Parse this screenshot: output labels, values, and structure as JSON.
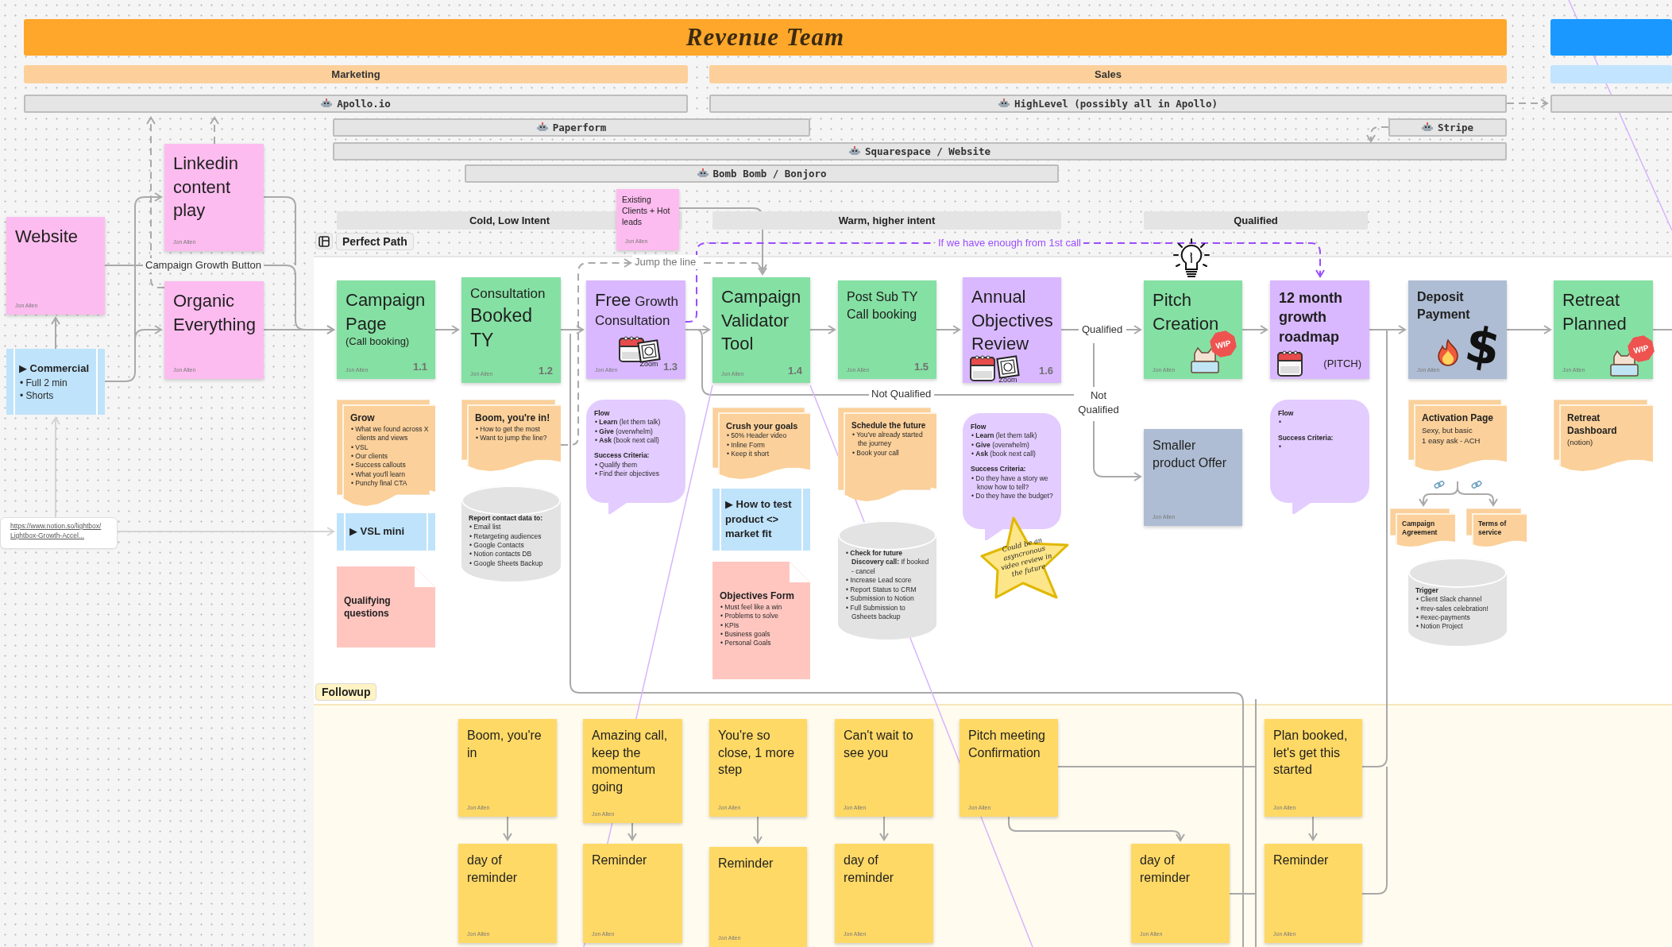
{
  "header": {
    "title": "Revenue Team"
  },
  "departments": [
    {
      "label": "Marketing"
    },
    {
      "label": "Sales"
    }
  ],
  "tools": [
    {
      "label": "Apollo.io"
    },
    {
      "label": "HighLevel (possibly all in Apollo)"
    },
    {
      "label": "Paperform"
    },
    {
      "label": "Stripe"
    },
    {
      "label": "Squarespace / Website"
    },
    {
      "label": "Bomb Bomb / Bonjoro"
    }
  ],
  "stages": [
    {
      "label": "Cold, Low Intent"
    },
    {
      "label": "Warm, higher intent"
    },
    {
      "label": "Qualified"
    }
  ],
  "sections": [
    {
      "label": "Perfect Path"
    },
    {
      "label": "Followup"
    }
  ],
  "labels": [
    {
      "text": "Campaign Growth Button"
    },
    {
      "text": "Jump the line"
    },
    {
      "text": "If we have enough from 1st call"
    },
    {
      "text": "Qualified"
    },
    {
      "text": "Not Qualified"
    },
    {
      "text": "Not Qualified"
    }
  ],
  "notes": [
    {
      "kind": "sticky",
      "color": "#fdbcef",
      "title": "Linkedin content play",
      "author": "Jon Allen"
    },
    {
      "kind": "sticky",
      "color": "#fdbcef",
      "lead": "Existing Clients + Hot leads",
      "author": "Jon Allen"
    },
    {
      "kind": "sticky",
      "color": "#fdbcef",
      "title": "Website",
      "author": "Jon Allen"
    },
    {
      "kind": "sticky",
      "color": "#fdbcef",
      "title": "Organic Everything",
      "author": "Jon Allen"
    },
    {
      "kind": "sticky",
      "color": "#85e0a3",
      "title": "Campaign Page",
      "subtitle": "(Call booking)",
      "author": "Jon Allen",
      "number": "1.1"
    },
    {
      "kind": "sticky",
      "color": "#85e0a3",
      "lead": "Consultation",
      "title": "Booked TY",
      "author": "Jon Allen",
      "number": "1.2"
    },
    {
      "kind": "sticky",
      "color": "#d9b8ff",
      "title": "Free",
      "tail": "Growth Consultation",
      "author": "Jon Allen",
      "number": "1.3",
      "stickers": [
        {
          "kind": "calendar"
        },
        {
          "kind": "zoom",
          "caption": "Zoom"
        }
      ]
    },
    {
      "kind": "sticky",
      "color": "#85e0a3",
      "title": "Campaign Validator Tool",
      "author": "Jon Allen",
      "number": "1.4"
    },
    {
      "kind": "sticky",
      "color": "#85e0a3",
      "lead": "Post Sub TY Call booking",
      "author": "Jon Allen",
      "number": "1.5"
    },
    {
      "kind": "sticky",
      "color": "#d9b8ff",
      "title": "Annual Objectives Review",
      "number": "1.6",
      "stickers": [
        {
          "kind": "calendar"
        },
        {
          "kind": "zoom",
          "caption": "Zoom"
        }
      ]
    },
    {
      "kind": "sticky",
      "color": "#85e0a3",
      "title": "Pitch Creation",
      "author": "Jon Allen",
      "stickers": [
        {
          "kind": "bulb"
        },
        {
          "kind": "cat"
        },
        {
          "kind": "wip",
          "caption": "WIP"
        }
      ]
    },
    {
      "kind": "sticky",
      "color": "#d9b8ff",
      "title": "12 month growth roadmap",
      "subtitle": "(PITCH)",
      "stickers": [
        {
          "kind": "calendar"
        }
      ]
    },
    {
      "kind": "sticky",
      "color": "#aebdd3",
      "lead": "Deposit Payment",
      "author": "Jon Allen",
      "stickers": [
        {
          "kind": "flame"
        },
        {
          "kind": "glyph",
          "text": "$"
        }
      ]
    },
    {
      "kind": "sticky",
      "color": "#85e0a3",
      "title": "Retreat Planned",
      "author": "Jon Allen",
      "stickers": [
        {
          "kind": "cat"
        },
        {
          "kind": "wip",
          "caption": "WIP"
        }
      ]
    },
    {
      "kind": "video",
      "title": "▶ Commercial",
      "bullets": [
        "• Full 2 min",
        "• Shorts"
      ]
    },
    {
      "kind": "doc",
      "title": "Grow",
      "bullets": [
        "• What we found across X clients and views",
        "• VSL",
        "• Our clients",
        "• Success callouts",
        "• What you'll learn",
        "• Punchy final CTA"
      ]
    },
    {
      "kind": "doc",
      "title": "Boom, you're in!",
      "bullets": [
        "• How to get the most",
        "• Want to jump the line?"
      ]
    },
    {
      "kind": "bubble",
      "groups": [
        {
          "heading": "Flow",
          "bullets": [
            "• **Learn** (let them talk)",
            "• **Give** (overwhelm)",
            "• **Ask** (book next call)"
          ]
        },
        {
          "heading": "Success Criteria:",
          "bullets": [
            "• Qualify them",
            "• Find their objectives"
          ]
        }
      ]
    },
    {
      "kind": "doc",
      "title": "Crush your goals",
      "bullets": [
        "• 50% Header video",
        "• Inline Form",
        "• Keep it short"
      ]
    },
    {
      "kind": "doc",
      "title": "Schedule the future",
      "bullets": [
        "• You've already started the journey",
        "• Book your call"
      ]
    },
    {
      "kind": "bubble",
      "groups": [
        {
          "heading": "Flow",
          "bullets": [
            "• **Learn** (let them talk)",
            "• **Give** (overwhelm)",
            "• **Ask** (book next call)"
          ]
        },
        {
          "heading": "Success Criteria:",
          "bullets": [
            "• Do they have a story we know how to tell?",
            "• Do they have the budget?"
          ]
        }
      ]
    },
    {
      "kind": "sticky",
      "color": "#aebdd3",
      "lead": "Smaller product Offer",
      "author": "Jon Allen"
    },
    {
      "kind": "bubble",
      "groups": [
        {
          "heading": "Flow",
          "bullets": [
            "•"
          ]
        },
        {
          "heading": "Success Criteria:",
          "bullets": [
            "•"
          ]
        }
      ]
    },
    {
      "kind": "doc",
      "title": "Activation Page",
      "lines": [
        "Sexy, but basic",
        "1 easy ask - ACH"
      ]
    },
    {
      "kind": "doc",
      "title": "Retreat Dashboard",
      "lines": [
        "(notion)"
      ]
    },
    {
      "kind": "link",
      "url_lines": [
        "https://www.notion.so/lightbox/",
        "Lightbox-Growth-Accel..."
      ]
    },
    {
      "kind": "video",
      "title": "▶ VSL mini"
    },
    {
      "kind": "cylinder",
      "heading": "Report contact data to:",
      "bullets": [
        "• Email list",
        "• Retargeting audiences",
        "• Google Contacts",
        "• Notion contacts DB",
        "• Google Sheets Backup"
      ]
    },
    {
      "kind": "video",
      "title": "▶ How to test product <> market fit"
    },
    {
      "kind": "cylinder",
      "bullets": [
        "• **Check for future Discovery call:** If booked - cancel",
        "• Increase Lead score",
        "• Report Status to CRM",
        "• Submission to Notion",
        "• Full Submission to Gsheets backup"
      ]
    },
    {
      "kind": "star",
      "text": "Could be an asyncronous video review in the future"
    },
    {
      "kind": "doc",
      "title": "Campaign Agreement"
    },
    {
      "kind": "doc",
      "title": "Terms of service"
    },
    {
      "kind": "page",
      "title": "Qualifying questions"
    },
    {
      "kind": "page",
      "title": "Objectives Form",
      "bullets": [
        "• Must feel like a win",
        "• Problems to solve",
        "• KPIs",
        "• Business goals",
        "• Personal Goals"
      ]
    },
    {
      "kind": "cylinder",
      "heading": "Trigger",
      "bullets": [
        "• Client Slack channel",
        "• #rev-sales celebration!",
        "• #exec-payments",
        "• Notion Project"
      ]
    },
    {
      "kind": "sticky",
      "color": "#ffd966",
      "title": "Boom, you're in",
      "author": "Jon Allen"
    },
    {
      "kind": "sticky",
      "color": "#ffd966",
      "title": "Amazing call, keep the momentum going",
      "author": "Jon Allen"
    },
    {
      "kind": "sticky",
      "color": "#ffd966",
      "title": "You're so close, 1 more step",
      "author": "Jon Allen"
    },
    {
      "kind": "sticky",
      "color": "#ffd966",
      "title": "Can't wait to see you",
      "author": "Jon Allen"
    },
    {
      "kind": "sticky",
      "color": "#ffd966",
      "title": "Pitch meeting Confirmation",
      "author": "Jon Allen"
    },
    {
      "kind": "sticky",
      "color": "#ffd966",
      "title": "Plan booked, let's get this started",
      "author": "Jon Allen"
    },
    {
      "kind": "sticky",
      "color": "#ffd966",
      "title": "day of reminder",
      "author": "Jon Allen"
    },
    {
      "kind": "sticky",
      "color": "#ffd966",
      "title": "Reminder",
      "author": "Jon Allen"
    },
    {
      "kind": "sticky",
      "color": "#ffd966",
      "title": "Reminder",
      "author": "Jon Allen"
    },
    {
      "kind": "sticky",
      "color": "#ffd966",
      "title": "day of reminder",
      "author": "Jon Allen"
    },
    {
      "kind": "sticky",
      "color": "#ffd966",
      "title": "day of reminder",
      "author": "Jon Allen"
    },
    {
      "kind": "sticky",
      "color": "#ffd966",
      "title": "Reminder",
      "author": "Jon Allen"
    }
  ]
}
